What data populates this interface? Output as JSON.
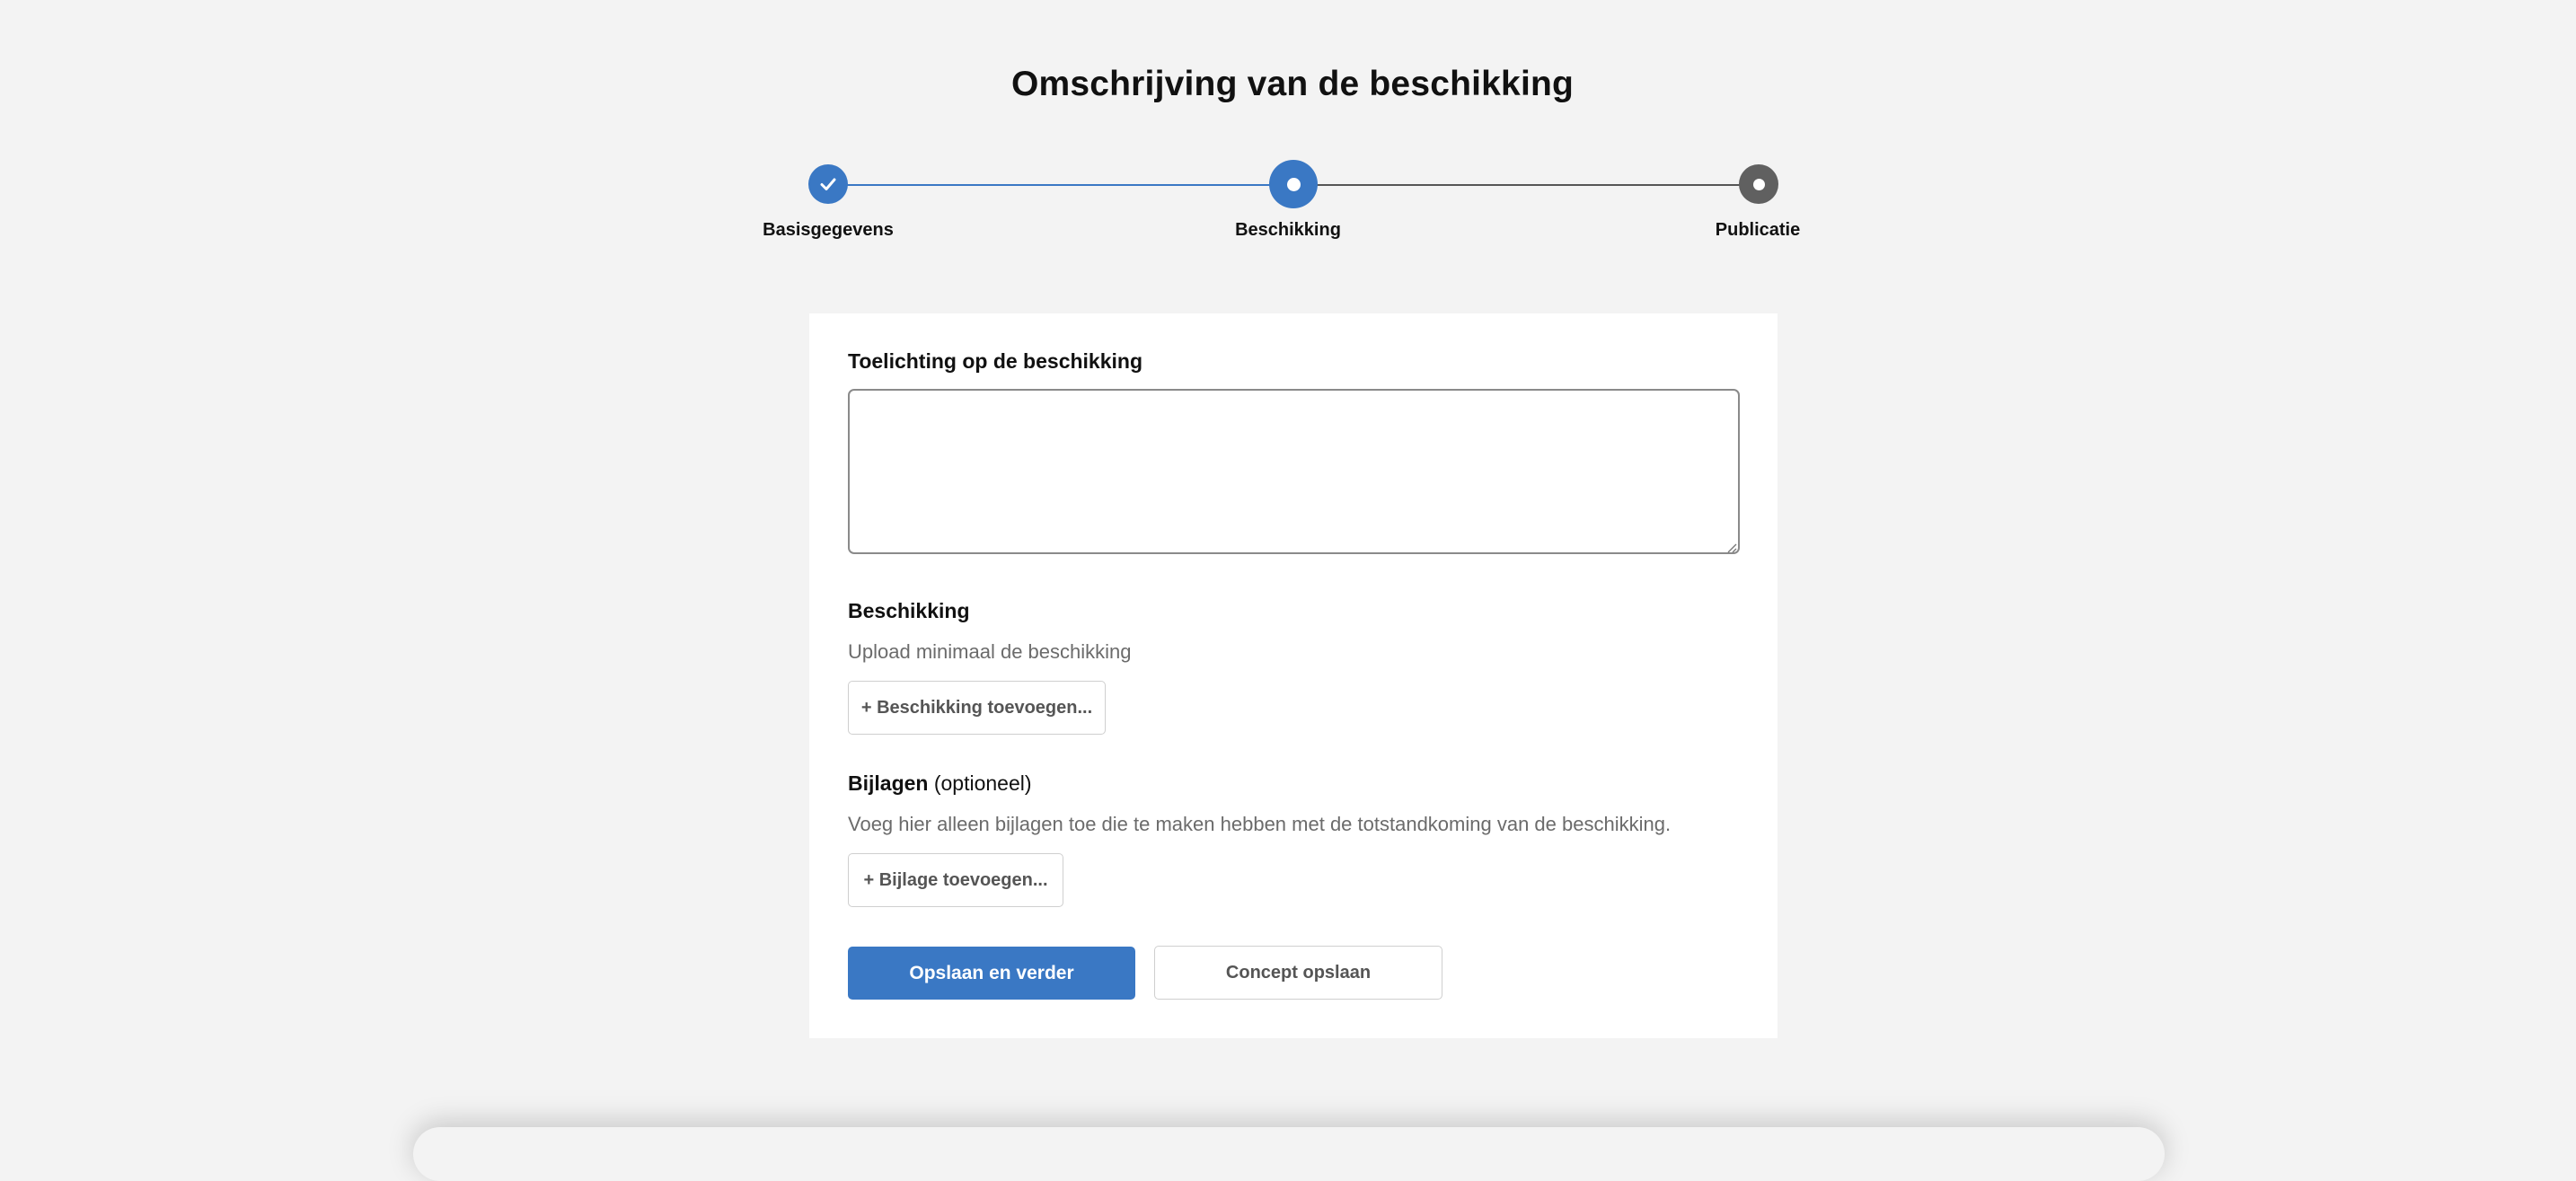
{
  "page": {
    "title": "Omschrijving van de beschikking"
  },
  "stepper": {
    "steps": [
      {
        "label": "Basisgegevens",
        "state": "done"
      },
      {
        "label": "Beschikking",
        "state": "current"
      },
      {
        "label": "Publicatie",
        "state": "upcoming"
      }
    ],
    "colors": {
      "active": "#3a78c4",
      "inactive": "#606060"
    }
  },
  "form": {
    "toelichting": {
      "label": "Toelichting op de beschikking",
      "value": ""
    },
    "beschikking": {
      "label": "Beschikking",
      "hint": "Upload minimaal de beschikking",
      "add_button": "+ Beschikking toevoegen..."
    },
    "bijlagen": {
      "label": "Bijlagen",
      "optional": "(optioneel)",
      "hint": "Voeg hier alleen bijlagen toe die te maken hebben met de totstandkoming van de beschikking.",
      "add_button": "+ Bijlage toevoegen..."
    },
    "actions": {
      "primary": "Opslaan en verder",
      "secondary": "Concept opslaan"
    }
  }
}
